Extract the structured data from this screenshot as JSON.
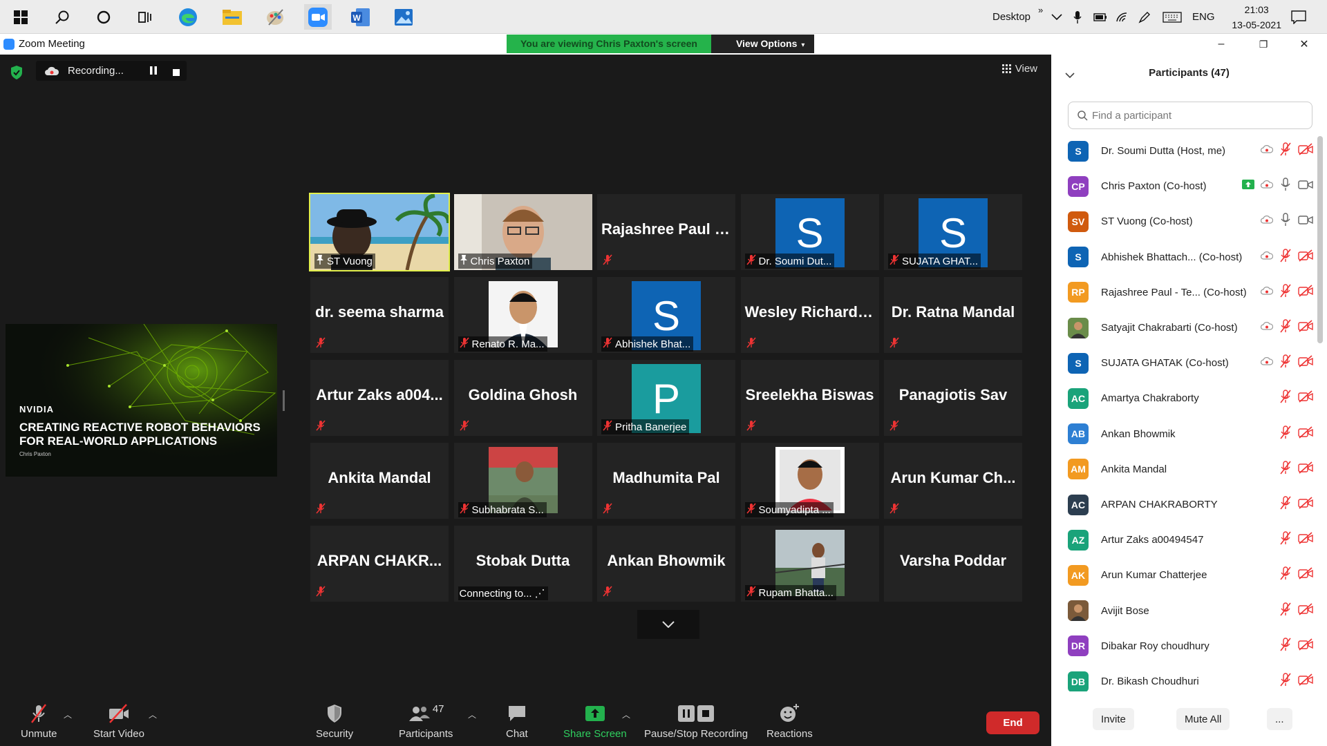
{
  "taskbar": {
    "desktop_label": "Desktop",
    "overflow": "»",
    "language": "ENG",
    "time": "21:03",
    "date": "13-05-2021"
  },
  "window": {
    "title": "Zoom Meeting",
    "banner": "You are viewing Chris Paxton's screen",
    "view_options": "View Options",
    "minimize": "–",
    "restore": "❐",
    "close": "✕"
  },
  "meeting": {
    "recording_label": "Recording...",
    "view_label": "View",
    "shared": {
      "brand": "NVIDIA",
      "title_line1": "CREATING REACTIVE ROBOT BEHAVIORS",
      "title_line2": "FOR REAL-WORLD APPLICATIONS",
      "presenter": "Chris Paxton"
    },
    "tiles": [
      {
        "display": "",
        "caption": "ST Vuong",
        "kind": "photo",
        "pin": true,
        "muted": false,
        "active": true
      },
      {
        "display": "",
        "caption": "Chris Paxton",
        "kind": "photo",
        "pin": true,
        "muted": false
      },
      {
        "display": "Rajashree  Paul  -...",
        "caption": "",
        "kind": "name",
        "muted": true
      },
      {
        "display": "S",
        "caption": "Dr. Soumi Dut...",
        "kind": "avatar",
        "color": "#0e64b4",
        "muted": true
      },
      {
        "display": "S",
        "caption": "SUJATA GHAT...",
        "kind": "avatar",
        "color": "#0e64b4",
        "muted": true
      },
      {
        "display": "dr. seema sharma",
        "caption": "",
        "kind": "name",
        "muted": true
      },
      {
        "display": "",
        "caption": "Renato R. Ma...",
        "kind": "photo",
        "muted": true
      },
      {
        "display": "S",
        "caption": "Abhishek Bhat...",
        "kind": "avatar",
        "color": "#0e64b4",
        "muted": true
      },
      {
        "display": "Wesley  Richards...",
        "caption": "",
        "kind": "name",
        "muted": true
      },
      {
        "display": "Dr. Ratna Mandal",
        "caption": "",
        "kind": "name",
        "muted": true
      },
      {
        "display": "Artur Zaks a004...",
        "caption": "",
        "kind": "name",
        "muted": true
      },
      {
        "display": "Goldina Ghosh",
        "caption": "",
        "kind": "name",
        "muted": true
      },
      {
        "display": "P",
        "caption": "Pritha Banerjee",
        "kind": "avatar",
        "color": "#1a9c9e",
        "muted": true
      },
      {
        "display": "Sreelekha Biswas",
        "caption": "",
        "kind": "name",
        "muted": true
      },
      {
        "display": "Panagiotis Sav",
        "caption": "",
        "kind": "name",
        "muted": true
      },
      {
        "display": "Ankita Mandal",
        "caption": "",
        "kind": "name",
        "muted": true
      },
      {
        "display": "",
        "caption": "Subhabrata S...",
        "kind": "photo",
        "muted": true
      },
      {
        "display": "Madhumita Pal",
        "caption": "",
        "kind": "name",
        "muted": true
      },
      {
        "display": "",
        "caption": "Soumyadipta ...",
        "kind": "photo",
        "muted": true
      },
      {
        "display": "Arun  Kumar  Ch...",
        "caption": "",
        "kind": "name",
        "muted": true
      },
      {
        "display": "ARPAN  CHAKR...",
        "caption": "",
        "kind": "name",
        "muted": true
      },
      {
        "display": "Stobak Dutta",
        "caption": "Connecting to... ⋰",
        "kind": "name",
        "muted": false
      },
      {
        "display": "Ankan Bhowmik",
        "caption": "",
        "kind": "name",
        "muted": true
      },
      {
        "display": "",
        "caption": "Rupam Bhatta...",
        "kind": "photo",
        "muted": true
      },
      {
        "display": "Varsha Poddar",
        "caption": "",
        "kind": "name",
        "muted": false
      }
    ]
  },
  "toolbar": {
    "unmute": "Unmute",
    "start_video": "Start Video",
    "security": "Security",
    "participants": "Participants",
    "participants_count": "47",
    "chat": "Chat",
    "share_screen": "Share Screen",
    "pause_stop_recording": "Pause/Stop Recording",
    "reactions": "Reactions",
    "end": "End"
  },
  "panel": {
    "title": "Participants (47)",
    "search_placeholder": "Find a participant",
    "participants": [
      {
        "initials": "S",
        "color": "#0e64b4",
        "name": "Dr. Soumi Dutta (Host, me)",
        "rec": true,
        "mic": "muted",
        "video": "off"
      },
      {
        "initials": "CP",
        "color": "#8f3fbf",
        "name": "Chris Paxton (Co-host)",
        "share": true,
        "rec": true,
        "mic": "on",
        "video": "on"
      },
      {
        "initials": "SV",
        "color": "#d05a0e",
        "name": "ST Vuong (Co-host)",
        "rec": true,
        "mic": "on",
        "video": "on"
      },
      {
        "initials": "S",
        "color": "#0e64b4",
        "name": "Abhishek Bhattach...  (Co-host)",
        "rec": true,
        "mic": "muted",
        "video": "off"
      },
      {
        "initials": "RP",
        "color": "#f29a21",
        "name": "Rajashree Paul - Te...  (Co-host)",
        "rec": true,
        "mic": "muted",
        "video": "off"
      },
      {
        "initials": "",
        "color": "#6a8c4a",
        "name": "Satyajit Chakrabarti (Co-host)",
        "photo": true,
        "rec": true,
        "mic": "muted",
        "video": "off"
      },
      {
        "initials": "S",
        "color": "#0e64b4",
        "name": "SUJATA GHATAK (Co-host)",
        "rec": true,
        "mic": "muted",
        "video": "off"
      },
      {
        "initials": "AC",
        "color": "#1aa37a",
        "name": "Amartya Chakraborty",
        "mic": "muted",
        "video": "off"
      },
      {
        "initials": "AB",
        "color": "#2d7fd3",
        "name": "Ankan Bhowmik",
        "mic": "muted",
        "video": "off"
      },
      {
        "initials": "AM",
        "color": "#f29a21",
        "name": "Ankita Mandal",
        "mic": "muted",
        "video": "off"
      },
      {
        "initials": "AC",
        "color": "#2c3e50",
        "name": "ARPAN CHAKRABORTY",
        "mic": "muted",
        "video": "off"
      },
      {
        "initials": "AZ",
        "color": "#1aa37a",
        "name": "Artur Zaks a00494547",
        "mic": "muted",
        "video": "off"
      },
      {
        "initials": "AK",
        "color": "#f29a21",
        "name": "Arun Kumar Chatterjee",
        "mic": "muted",
        "video": "off"
      },
      {
        "initials": "",
        "color": "#7b5a3a",
        "name": "Avijit Bose",
        "photo": true,
        "mic": "muted",
        "video": "off"
      },
      {
        "initials": "DR",
        "color": "#8f3fbf",
        "name": "Dibakar Roy choudhury",
        "mic": "muted",
        "video": "off"
      },
      {
        "initials": "DB",
        "color": "#1aa37a",
        "name": "Dr. Bikash Choudhuri",
        "mic": "muted",
        "video": "off"
      }
    ],
    "invite": "Invite",
    "mute_all": "Mute All",
    "more": "..."
  }
}
